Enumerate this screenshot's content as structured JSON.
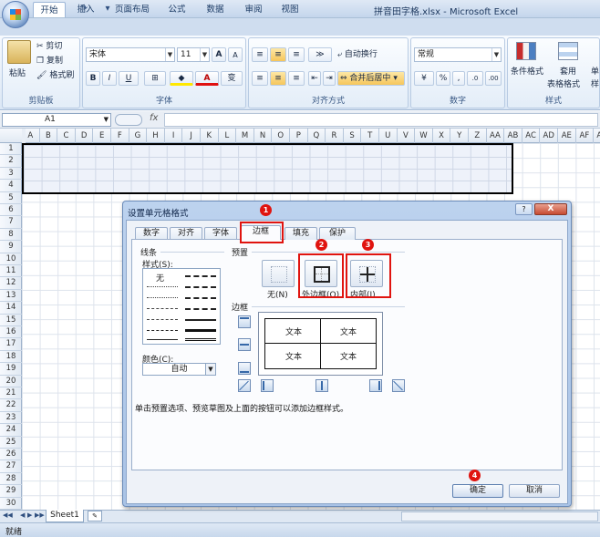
{
  "window": {
    "title": "拼音田字格.xlsx - Microsoft Excel"
  },
  "quick_access": [
    "💾",
    "↶",
    "↷",
    "▾"
  ],
  "tabs": [
    "开始",
    "插入",
    "页面布局",
    "公式",
    "数据",
    "审阅",
    "视图"
  ],
  "ribbon": {
    "clipboard": {
      "paste": "粘贴",
      "cut": "剪切",
      "copy": "复制",
      "format_painter": "格式刷",
      "group": "剪贴板"
    },
    "font": {
      "name": "宋体",
      "size": "11",
      "grow": "A",
      "shrink": "A",
      "bold": "B",
      "italic": "I",
      "underline": "U",
      "group": "字体"
    },
    "alignment": {
      "wrap": "自动换行",
      "merge": "合并后居中",
      "group": "对齐方式"
    },
    "number": {
      "format": "常规",
      "percent": "%",
      "comma": ",",
      "inc": ".0",
      "dec": ".00",
      "group": "数字"
    },
    "styles": {
      "conditional": "条件格式",
      "table": "套用",
      "table2": "表格格式",
      "cell": "单",
      "cell2": "样",
      "group": "样式"
    }
  },
  "formula_bar": {
    "name_box": "A1",
    "fx": "fx"
  },
  "columns": [
    "A",
    "B",
    "C",
    "D",
    "E",
    "F",
    "G",
    "H",
    "I",
    "J",
    "K",
    "L",
    "M",
    "N",
    "O",
    "P",
    "Q",
    "R",
    "S",
    "T",
    "U",
    "V",
    "W",
    "X",
    "Y",
    "Z",
    "AA",
    "AB",
    "AC",
    "AD",
    "AE",
    "AF",
    "AG"
  ],
  "rows": [
    "1",
    "2",
    "3",
    "4",
    "5",
    "6",
    "7",
    "8",
    "9",
    "10",
    "11",
    "12",
    "13",
    "14",
    "15",
    "16",
    "17",
    "18",
    "19",
    "20",
    "21",
    "22",
    "23",
    "24",
    "25",
    "26",
    "27",
    "28",
    "29",
    "30"
  ],
  "sheet_tab": "Sheet1",
  "status": "就绪",
  "dialog": {
    "title": "设置单元格格式",
    "help": "?",
    "close": "X",
    "tabs": [
      "数字",
      "对齐",
      "字体",
      "边框",
      "填充",
      "保护"
    ],
    "line_section": "线条",
    "style_label": "样式(S):",
    "none_style": "无",
    "color_label": "颜色(C):",
    "color_value": "自动",
    "presets_label": "预置",
    "presets": [
      "无(N)",
      "外边框(O)",
      "内部(I)"
    ],
    "border_label": "边框",
    "preview_cells": [
      "文本",
      "文本",
      "文本",
      "文本"
    ],
    "hint": "单击预置选项、预览草图及上面的按钮可以添加边框样式。",
    "ok": "确定",
    "cancel": "取消",
    "badges": [
      "1",
      "2",
      "3",
      "4"
    ]
  }
}
